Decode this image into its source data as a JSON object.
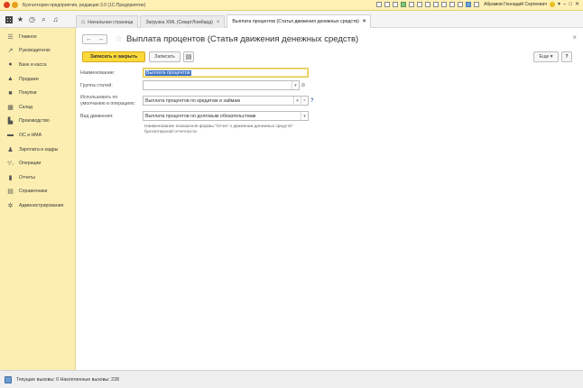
{
  "titlebar": {
    "title": "Бухгалтерия предприятия, редакция 3.0  (1С:Предприятие)",
    "user": "Абрамов Геннадий Сергеевич"
  },
  "nav": {
    "tabs": [
      {
        "label": "Начальная страница",
        "icon": "home-icon"
      },
      {
        "label": "Загрузка XML (СмартЛомбард)",
        "closable": true
      },
      {
        "label": "Выплата процентов (Статья движения денежных средств)",
        "closable": true,
        "active": true
      }
    ]
  },
  "sidebar": {
    "items": [
      {
        "label": "Главное",
        "icon": "menu-icon"
      },
      {
        "label": "Руководителю",
        "icon": "chart-icon"
      },
      {
        "label": "Банк и касса",
        "icon": "bank-icon"
      },
      {
        "label": "Продажи",
        "icon": "bag-icon"
      },
      {
        "label": "Покупки",
        "icon": "cart-icon"
      },
      {
        "label": "Склад",
        "icon": "warehouse-icon"
      },
      {
        "label": "Производство",
        "icon": "factory-icon"
      },
      {
        "label": "ОС и НМА",
        "icon": "truck-icon"
      },
      {
        "label": "Зарплата и кадры",
        "icon": "person-icon"
      },
      {
        "label": "Операции",
        "icon": "operations-icon"
      },
      {
        "label": "Отчеты",
        "icon": "reports-icon"
      },
      {
        "label": "Справочники",
        "icon": "book-icon"
      },
      {
        "label": "Администрирование",
        "icon": "gear-icon"
      }
    ]
  },
  "form": {
    "title": "Выплата процентов (Статья движения денежных средств)",
    "buttons": {
      "save_close": "Записать и закрыть",
      "save": "Записать",
      "more": "Еще",
      "help": "?"
    },
    "fields": {
      "name_label": "Наименование:",
      "name_value": "Выплата процентов",
      "group_label": "Группа статей:",
      "group_value": "",
      "default_label": "Использовать по умолчанию в операциях:",
      "default_value": "Выплата процентов по кредитам и займам",
      "movement_label": "Вид движения:",
      "movement_value": "Выплата процентов по долговым обязательствам",
      "movement_hint": "Наименование показателя формы \"Отчет о движении денежных средств\" бухгалтерской отчетности"
    }
  },
  "status": {
    "text": "Текущие вызовы: 0   Накопленные вызовы: 228"
  }
}
